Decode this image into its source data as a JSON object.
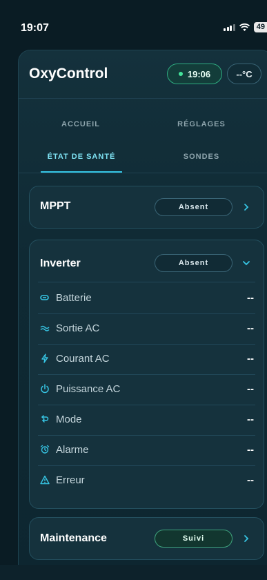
{
  "status_bar": {
    "time": "19:07",
    "battery": "49"
  },
  "header": {
    "title": "OxyControl",
    "time_pill": "19:06",
    "temperature_pill": "--°C"
  },
  "tabs": [
    {
      "label": "ACCUEIL",
      "active": false
    },
    {
      "label": "RÉGLAGES",
      "active": false
    },
    {
      "label": "ÉTAT DE SANTÉ",
      "active": true
    },
    {
      "label": "SONDES",
      "active": false
    }
  ],
  "cards": {
    "mppt": {
      "title": "MPPT",
      "status": "Absent"
    },
    "inverter": {
      "title": "Inverter",
      "status": "Absent",
      "rows": [
        {
          "label": "Batterie",
          "value": "--",
          "icon": "battery-icon"
        },
        {
          "label": "Sortie AC",
          "value": "--",
          "icon": "wave-icon"
        },
        {
          "label": "Courant AC",
          "value": "--",
          "icon": "lightning-icon"
        },
        {
          "label": "Puissance AC",
          "value": "--",
          "icon": "power-icon"
        },
        {
          "label": "Mode",
          "value": "--",
          "icon": "loop-arrow-icon"
        },
        {
          "label": "Alarme",
          "value": "--",
          "icon": "alarm-clock-icon"
        },
        {
          "label": "Erreur",
          "value": "--",
          "icon": "warning-triangle-icon"
        }
      ]
    },
    "maintenance": {
      "title": "Maintenance",
      "status": "Suivi"
    }
  },
  "colors": {
    "background": "#0a1c24",
    "card": "#15323d",
    "accent": "#37c6e5",
    "ok_green": "#44e49b"
  }
}
